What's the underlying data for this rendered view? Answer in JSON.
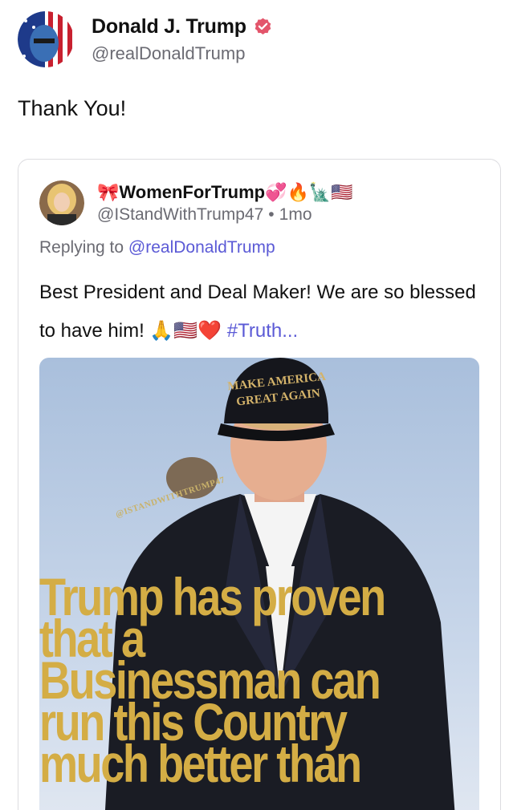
{
  "post": {
    "author_name": "Donald J. Trump",
    "author_handle": "@realDonaldTrump",
    "text": "Thank You!"
  },
  "quote": {
    "author_name": "🎀WomenForTrump💞🔥🗽🇺🇸",
    "author_handle": "@IStandWithTrump47",
    "time_separator": "•",
    "time_ago": "1mo",
    "replying_prefix": "Replying to",
    "replying_mention": "@realDonaldTrump",
    "body_text": "Best President and Deal Maker! We are so blessed to have him! 🙏🇺🇸❤️",
    "hashtag": "#Truth...",
    "image": {
      "hat_text_line1": "MAKE AMERICA",
      "hat_text_line2": "GREAT AGAIN",
      "watermark": "@ISTANDWITHTRUMP47",
      "overlay_lines": [
        "Trump has proven",
        "that a",
        "Businessman can",
        "run this Country",
        "much better than"
      ]
    }
  },
  "colors": {
    "accent": "#5b5ad6",
    "verified": "#e3556b",
    "overlay_gold": "#d4ad45",
    "muted_text": "#6b6b73"
  },
  "icons": {
    "verified": "verified-badge-icon"
  }
}
